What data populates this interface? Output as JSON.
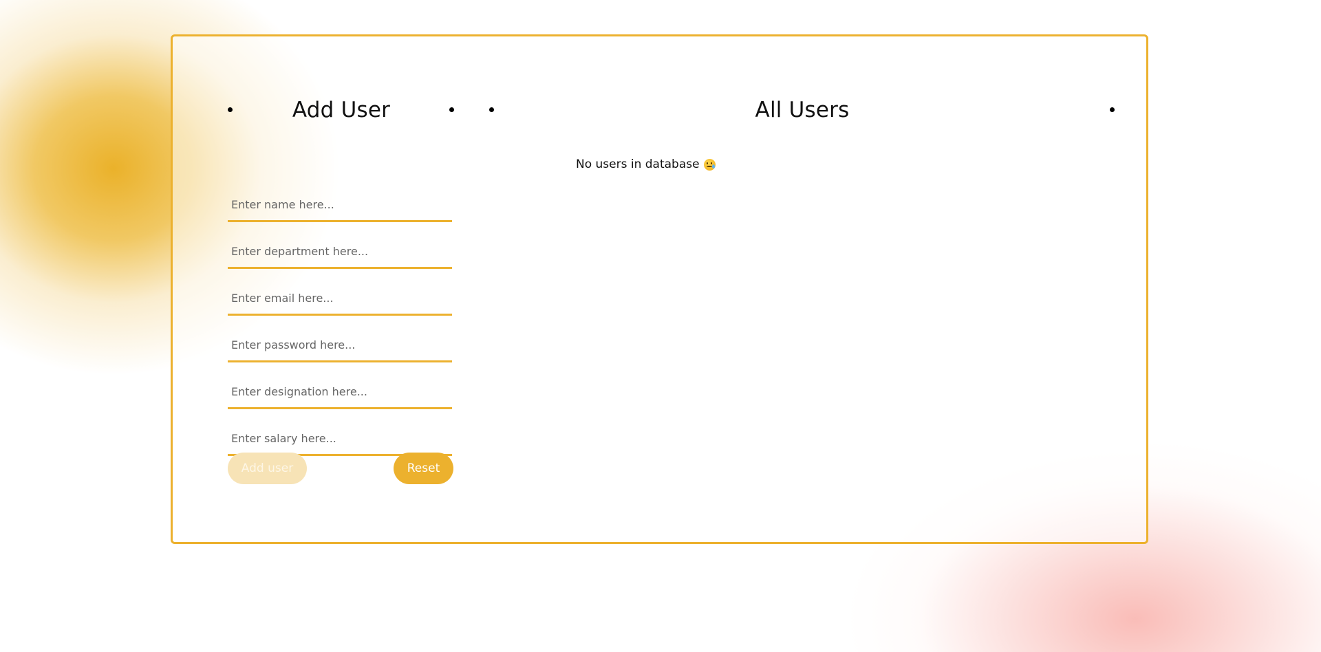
{
  "add_user": {
    "title": "Add User",
    "fields": [
      {
        "name": "name",
        "placeholder": "Enter name here...",
        "value": ""
      },
      {
        "name": "department",
        "placeholder": "Enter department here...",
        "value": ""
      },
      {
        "name": "email",
        "placeholder": "Enter email here...",
        "value": ""
      },
      {
        "name": "password",
        "placeholder": "Enter password here...",
        "value": ""
      },
      {
        "name": "designation",
        "placeholder": "Enter designation here...",
        "value": ""
      },
      {
        "name": "salary",
        "placeholder": "Enter salary here...",
        "value": ""
      }
    ],
    "add_button_label": "Add user",
    "add_button_state": "disabled",
    "reset_button_label": "Reset"
  },
  "all_users": {
    "title": "All Users",
    "empty_message": "No users in database",
    "empty_icon": "sad-face-with-tear-icon",
    "users": []
  },
  "colors": {
    "accent": "#ecb12e",
    "accent_disabled": "#f7e3b6",
    "blob_left": "#eab026",
    "blob_right": "#f9b9b4"
  }
}
